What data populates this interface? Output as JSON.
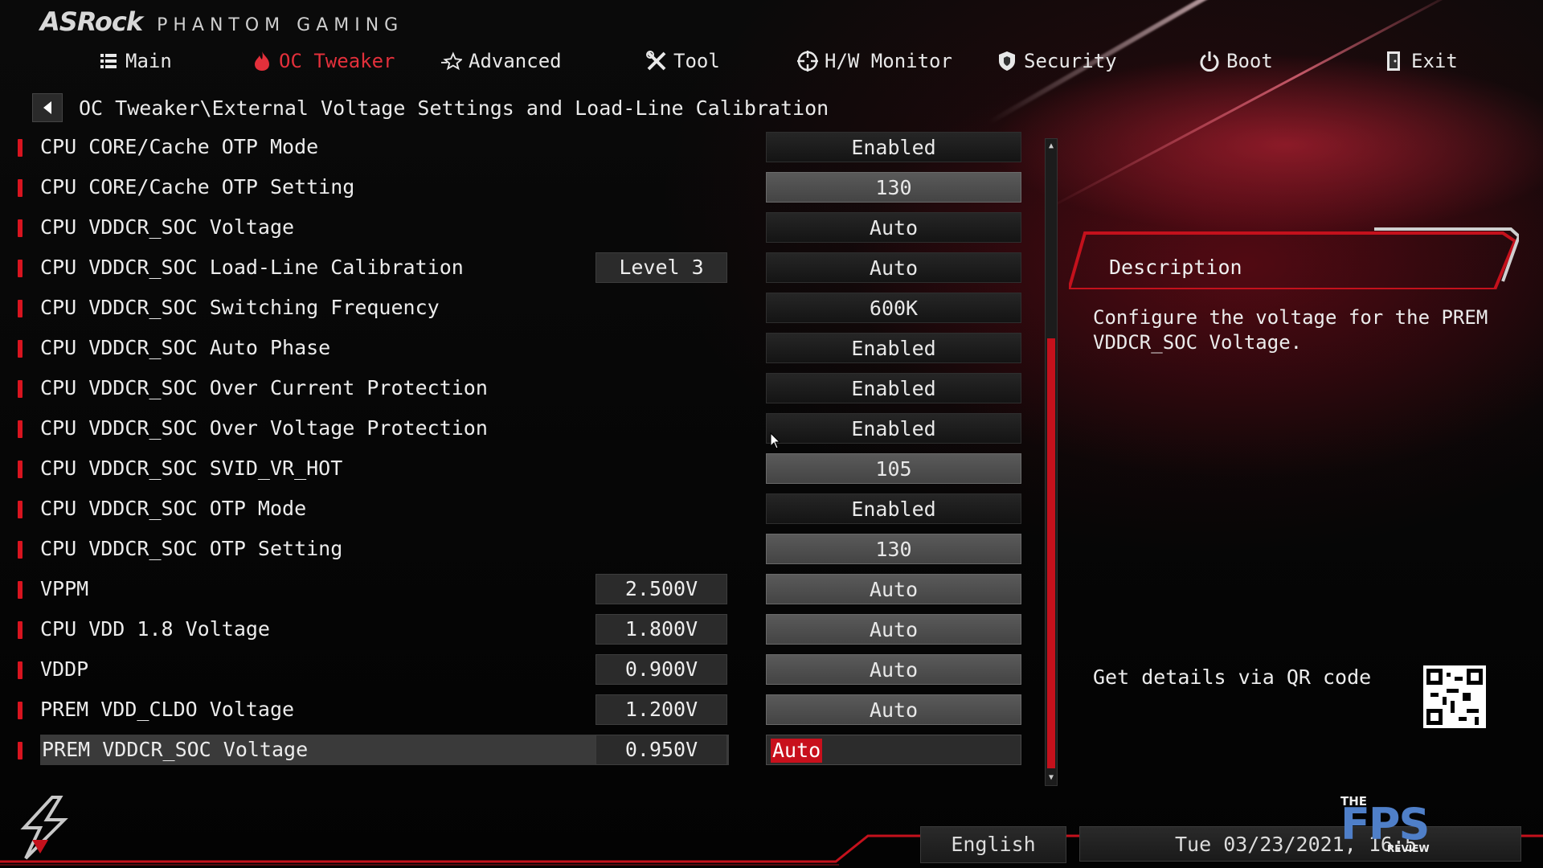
{
  "brand": {
    "name": "ASRock",
    "subtitle": "PHANTOM GAMING"
  },
  "nav": {
    "tabs": [
      {
        "label": "Main",
        "icon": "list-icon",
        "active": false
      },
      {
        "label": "OC Tweaker",
        "icon": "flame-icon",
        "active": true
      },
      {
        "label": "Advanced",
        "icon": "star-icon",
        "active": false
      },
      {
        "label": "Tool",
        "icon": "tools-icon",
        "active": false
      },
      {
        "label": "H/W Monitor",
        "icon": "crosshair-icon",
        "active": false
      },
      {
        "label": "Security",
        "icon": "shield-icon",
        "active": false
      },
      {
        "label": "Boot",
        "icon": "power-icon",
        "active": false
      },
      {
        "label": "Exit",
        "icon": "door-exit-icon",
        "active": false
      }
    ]
  },
  "breadcrumb": "OC Tweaker\\External Voltage Settings and Load-Line Calibration",
  "settings": [
    {
      "label": "CPU CORE/Cache OTP Mode",
      "current": "",
      "value": "Enabled",
      "kind": "opt"
    },
    {
      "label": "CPU CORE/Cache OTP Setting",
      "current": "",
      "value": "130",
      "kind": "num"
    },
    {
      "label": "CPU VDDCR_SOC Voltage",
      "current": "",
      "value": "Auto",
      "kind": "opt"
    },
    {
      "label": "CPU VDDCR_SOC Load-Line Calibration",
      "current": "Level 3",
      "value": "Auto",
      "kind": "opt"
    },
    {
      "label": "CPU VDDCR_SOC Switching Frequency",
      "current": "",
      "value": "600K",
      "kind": "opt"
    },
    {
      "label": "CPU VDDCR_SOC Auto Phase",
      "current": "",
      "value": "Enabled",
      "kind": "opt"
    },
    {
      "label": "CPU VDDCR_SOC Over Current Protection",
      "current": "",
      "value": "Enabled",
      "kind": "opt"
    },
    {
      "label": "CPU VDDCR_SOC Over Voltage Protection",
      "current": "",
      "value": "Enabled",
      "kind": "opt"
    },
    {
      "label": "CPU VDDCR_SOC SVID_VR_HOT",
      "current": "",
      "value": "105",
      "kind": "num"
    },
    {
      "label": "CPU VDDCR_SOC OTP Mode",
      "current": "",
      "value": "Enabled",
      "kind": "opt"
    },
    {
      "label": "CPU VDDCR_SOC OTP Setting",
      "current": "",
      "value": "130",
      "kind": "num"
    },
    {
      "label": "VPPM",
      "current": "2.500V",
      "value": "Auto",
      "kind": "num"
    },
    {
      "label": "CPU VDD 1.8 Voltage",
      "current": "1.800V",
      "value": "Auto",
      "kind": "num"
    },
    {
      "label": "VDDP",
      "current": "0.900V",
      "value": "Auto",
      "kind": "num"
    },
    {
      "label": "PREM VDD_CLDO Voltage",
      "current": "1.200V",
      "value": "Auto",
      "kind": "num"
    },
    {
      "label": "PREM VDDCR_SOC Voltage",
      "current": "0.950V",
      "value": "Auto",
      "kind": "edit",
      "selected": true
    }
  ],
  "description": {
    "title": "Description",
    "text": "Configure the voltage for the PREM VDDCR_SOC Voltage.",
    "qr_label": "Get details via QR code"
  },
  "footer": {
    "language": "English",
    "datetime": "Tue 03/23/2021, 16:5"
  },
  "watermark": {
    "the": "THE",
    "fps": "FPS",
    "review": "REVIEW"
  },
  "colors": {
    "accent": "#d8141f",
    "active_tab": "#e3303b",
    "scroll_thumb": "#c4111c"
  }
}
